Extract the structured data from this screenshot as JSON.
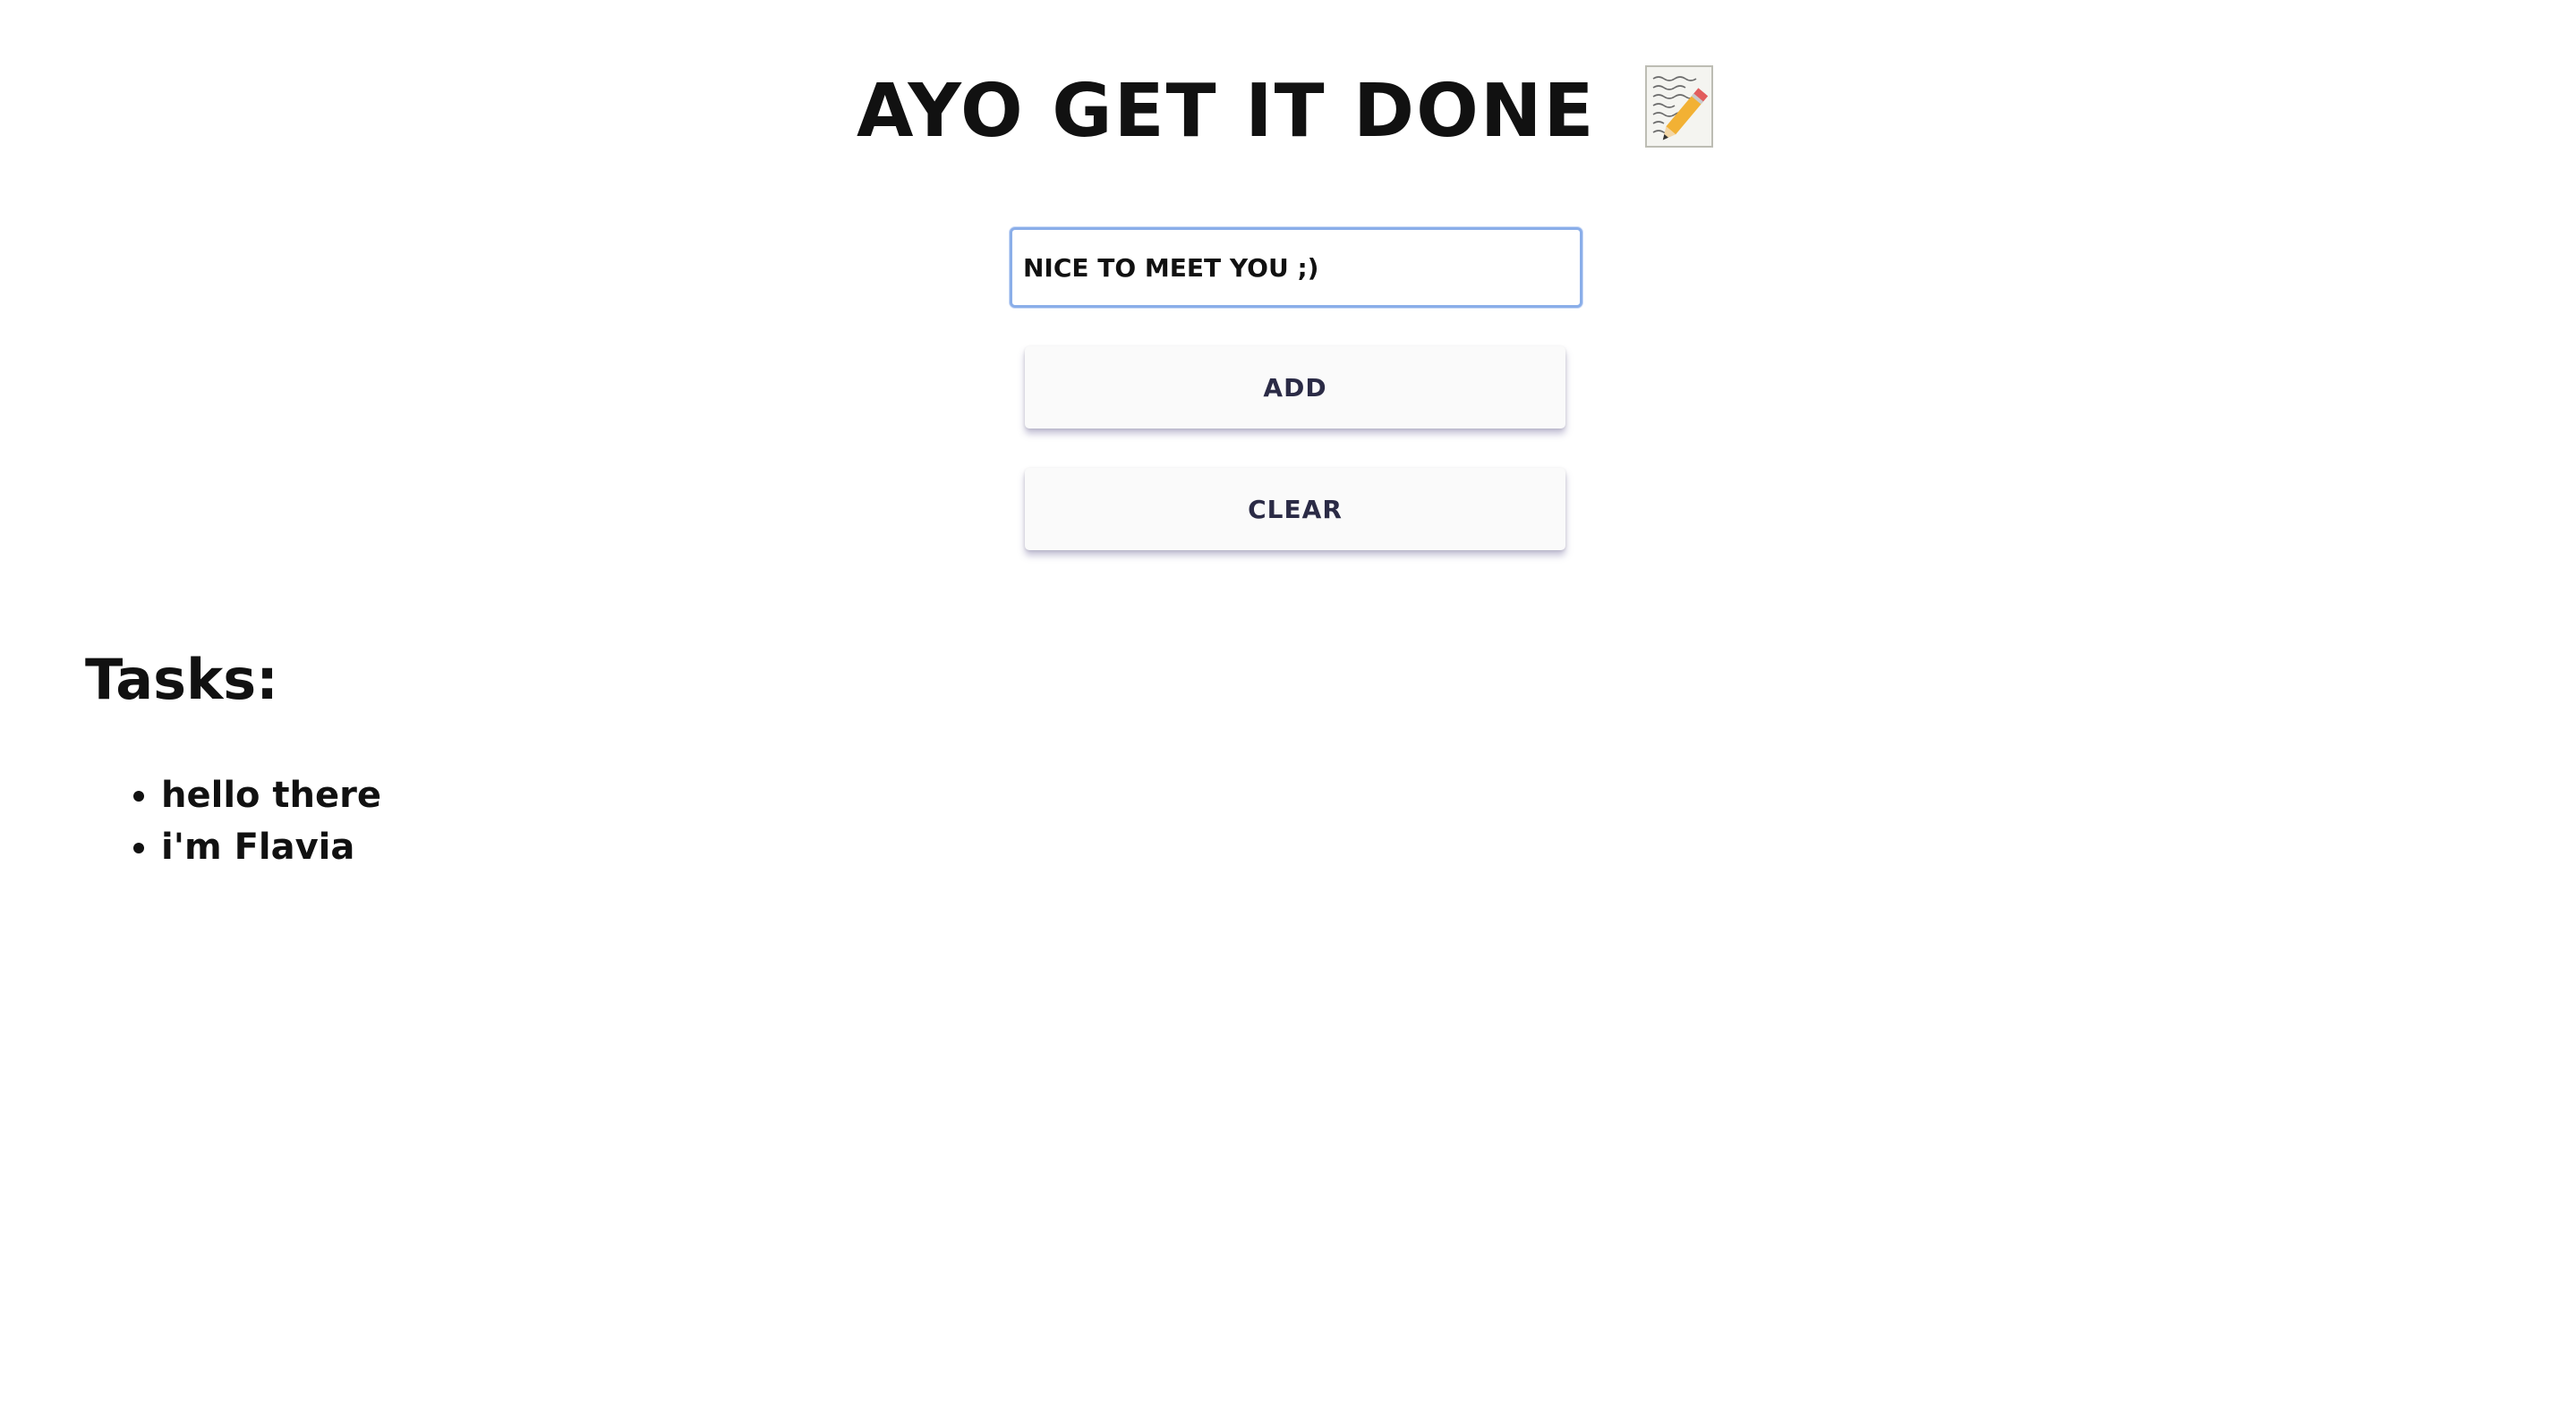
{
  "app": {
    "title": "Ayo get it done",
    "title_icon": "memo-pencil-icon"
  },
  "form": {
    "input_value": "nice to meet you ;)",
    "add_label": "Add",
    "clear_label": "Clear"
  },
  "tasks": {
    "heading": "Tasks:",
    "items": [
      "hello there",
      "i'm Flavia"
    ]
  },
  "colors": {
    "input_focus_border": "#8aaee9",
    "button_text": "#2b2b46",
    "button_background": "#fafafa"
  }
}
